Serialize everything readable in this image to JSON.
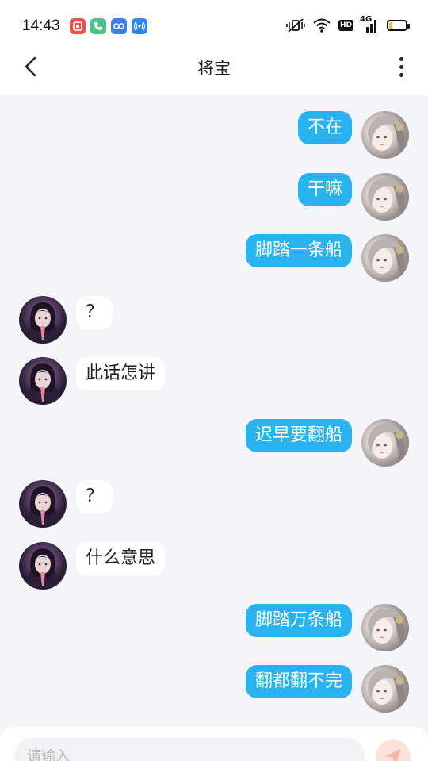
{
  "status_bar": {
    "time": "14:43",
    "notifications": [
      "app-icon",
      "phone-icon",
      "loop-icon",
      "signal-icon"
    ],
    "network": "4G",
    "hd": "HD",
    "battery_level": 0.2
  },
  "header": {
    "title": "将宝",
    "back_icon": "chevron-left-icon",
    "more_icon": "more-vertical-icon"
  },
  "messages": [
    {
      "from": "self",
      "text": "不在"
    },
    {
      "from": "self",
      "text": "干嘛"
    },
    {
      "from": "self",
      "text": "脚踏一条船"
    },
    {
      "from": "other",
      "text": "？"
    },
    {
      "from": "other",
      "text": "此话怎讲"
    },
    {
      "from": "self",
      "text": "迟早要翻船"
    },
    {
      "from": "other",
      "text": "？"
    },
    {
      "from": "other",
      "text": "什么意思"
    },
    {
      "from": "self",
      "text": "脚踏万条船"
    },
    {
      "from": "self",
      "text": "翻都翻不完"
    }
  ],
  "composer": {
    "placeholder": "请输入",
    "send_icon": "send-icon"
  },
  "colors": {
    "self_bubble": "#29b3ee",
    "other_bubble": "#ffffff",
    "background": "#f3f5f8"
  }
}
